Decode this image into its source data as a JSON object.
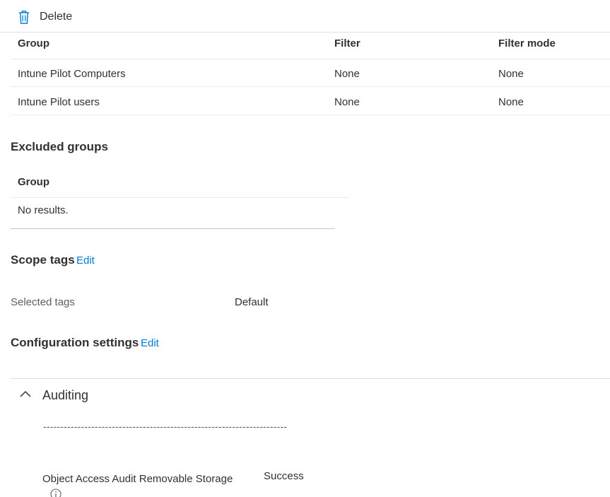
{
  "toolbar": {
    "delete_label": "Delete"
  },
  "included_table": {
    "headers": {
      "group": "Group",
      "filter": "Filter",
      "filter_mode": "Filter mode"
    },
    "rows": [
      {
        "group": "Intune Pilot Computers",
        "filter": "None",
        "filter_mode": "None"
      },
      {
        "group": "Intune Pilot users",
        "filter": "None",
        "filter_mode": "None"
      }
    ]
  },
  "excluded_groups": {
    "title": "Excluded groups",
    "header_group": "Group",
    "empty_text": "No results."
  },
  "scope_tags": {
    "title": "Scope tags",
    "edit_label": "Edit",
    "selected_label": "Selected tags",
    "selected_value": "Default"
  },
  "configuration_settings": {
    "title": "Configuration settings",
    "edit_label": "Edit",
    "auditing": {
      "label": "Auditing",
      "separator": "-----------------------------------------------------------------------",
      "setting_name": "Object Access Audit Removable Storage",
      "setting_value": "Success"
    }
  },
  "colors": {
    "accent": "#0078d4",
    "text": "#323130",
    "muted": "#605e5c",
    "border": "#e1dfdd"
  }
}
